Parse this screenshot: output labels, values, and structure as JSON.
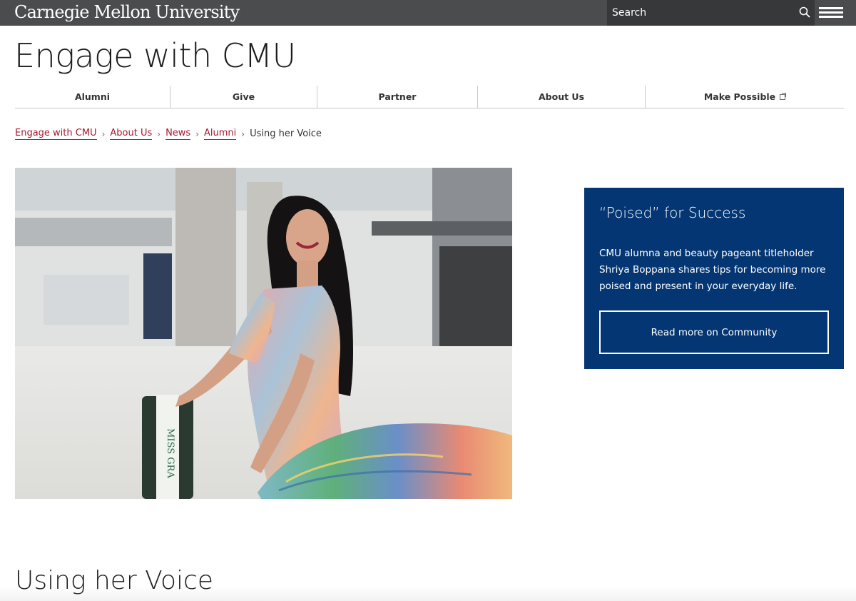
{
  "header": {
    "wordmark": "Carnegie Mellon University",
    "search_placeholder": "Search",
    "menu_icon": "hamburger-menu-icon",
    "search_icon": "search-icon"
  },
  "site_title": "Engage with CMU",
  "nav": {
    "items": [
      {
        "label": "Alumni"
      },
      {
        "label": "Give"
      },
      {
        "label": "Partner"
      },
      {
        "label": "About Us"
      },
      {
        "label": "Make Possible",
        "icon": "external-link-icon"
      }
    ]
  },
  "breadcrumb": {
    "links": [
      "Engage with CMU",
      "About Us",
      "News",
      "Alumni"
    ],
    "current": "Using her Voice",
    "separator": "›"
  },
  "hero": {
    "sash_text": "MISS GRA"
  },
  "card": {
    "title": "“Poised” for Success",
    "text": "CMU alumna and beauty pageant titleholder Shriya Boppana shares tips for becoming more poised and present in your everyday life.",
    "button_label": "Read more on Community"
  },
  "article_title": "Using her Voice",
  "colors": {
    "topbar": "#4a4c4e",
    "search_bg": "#36383a",
    "link_red": "#a6192e",
    "card_blue": "#043673"
  }
}
